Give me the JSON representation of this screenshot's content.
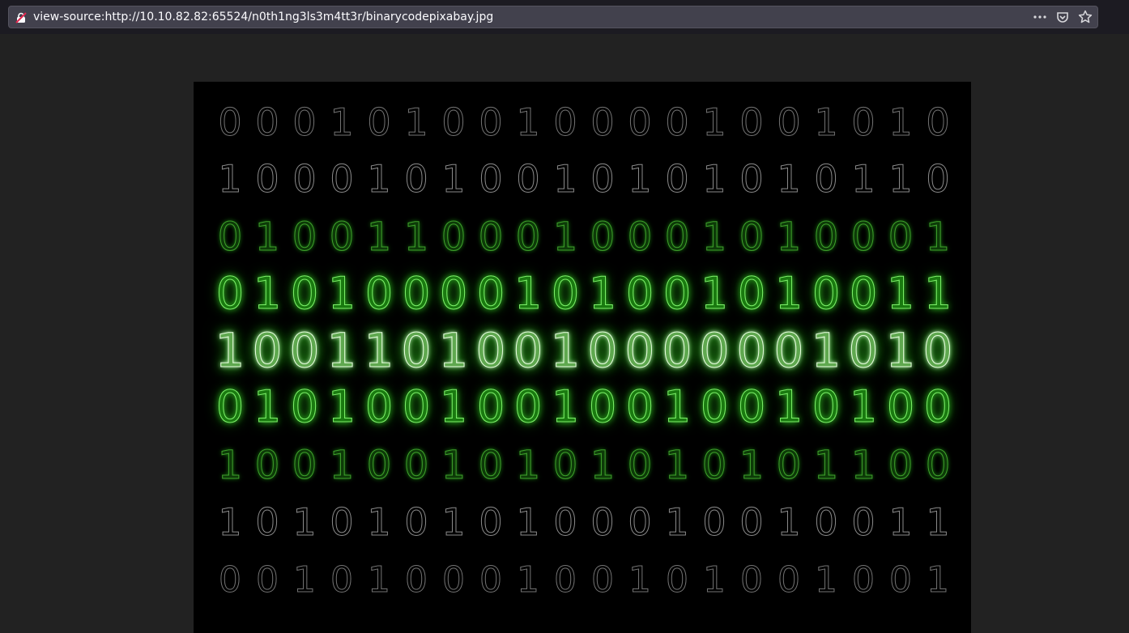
{
  "browser": {
    "url": "view-source:http://10.10.82.82:65524/n0th1ng3ls3m4tt3r/binarycodepixabay.jpg",
    "icons": {
      "security": "insecure-connection-icon",
      "page_actions": "more-actions-icon",
      "pocket": "pocket-icon",
      "bookmark": "bookmark-star-icon"
    }
  },
  "image": {
    "description_rows": [
      {
        "digits": "00010100100001001010",
        "style": "white-faint"
      },
      {
        "digits": "10001010010101010110",
        "style": "white-faint"
      },
      {
        "digits": "01001100010001010001",
        "style": "green-dim"
      },
      {
        "digits": "01010000101001010011",
        "style": "green-bright"
      },
      {
        "digits": "10011010010000001010",
        "style": "green-white-glow"
      },
      {
        "digits": "01010010010010010100",
        "style": "green-bright"
      },
      {
        "digits": "10010010101010101100",
        "style": "green-dim"
      },
      {
        "digits": "10101010100010010011",
        "style": "white-faint"
      },
      {
        "digits": "00101000100101001001",
        "style": "white-faint"
      }
    ],
    "colors": {
      "green-bright": "#33cc22",
      "green-glow": "#1a8a10",
      "white-faint": "#9a9a9a",
      "background": "#000000"
    }
  }
}
